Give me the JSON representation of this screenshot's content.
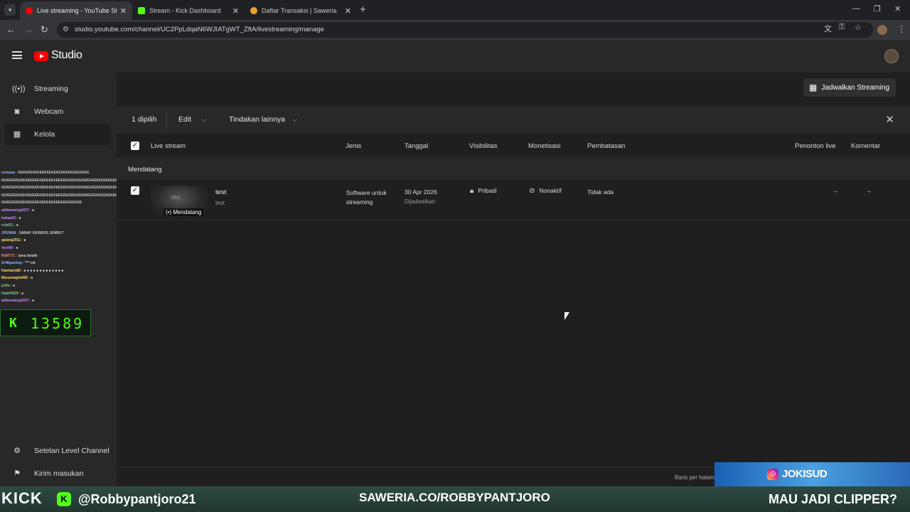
{
  "browser": {
    "tabs": [
      {
        "title": "Live streaming - YouTube Studio",
        "active": true,
        "favicon_color": "#ff0000"
      },
      {
        "title": "Stream - Kick Dashboard",
        "active": false,
        "favicon_color": "#53fc18"
      },
      {
        "title": "Daftar Transaksi | Saweria",
        "active": false,
        "favicon_color": "#f0a030"
      }
    ],
    "url": "studio.youtube.com/channel/UC2PpLdqaN6WJIATgWT_ZftA/livestreaming/manage"
  },
  "header": {
    "logo_text": "Studio"
  },
  "sidebar": {
    "items": [
      {
        "label": "Streaming",
        "icon": "broadcast-icon"
      },
      {
        "label": "Webcam",
        "icon": "camera-icon"
      },
      {
        "label": "Kelola",
        "icon": "calendar-icon"
      }
    ],
    "bottom_items": [
      {
        "label": "Setelan Level Channel",
        "icon": "gear-icon"
      },
      {
        "label": "Kirim masukan",
        "icon": "feedback-icon"
      }
    ]
  },
  "chat": {
    "lines": [
      {
        "user": "notepaa :",
        "text": "KEKEKEKEKEKEKEKEKEKEKEKEKEKEKE",
        "color": "#8ab4f8"
      },
      {
        "user": "",
        "text": "KEKEKEKEKEKEKEKEKEKEKEKEKEKEKEKEKEKEKEKEKEKEKEKEKEKEKE",
        "color": "#ffffff"
      },
      {
        "user": "",
        "text": "KEKEKEKEKEKEKEKEKEKEKEKEKEKEKEKEKEKEKEKEKEKEKEKEKEKEKE",
        "color": "#ffffff"
      },
      {
        "user": "",
        "text": "KEKEKEKEKEKEKEKEKEKEKEKEKEKEKEKEKEKEKEKEKEKEKEKEKEKEKE",
        "color": "#ffffff"
      },
      {
        "user": "",
        "text": "KEKEKEKEKEKEKEKEKEKEKEKEKEKEKEKEKE",
        "color": "#ffffff"
      },
      {
        "user": "aditmewing1637 :",
        "text": "●",
        "color": "#c58af9"
      },
      {
        "user": "hahaa02 :",
        "text": "●",
        "color": "#c58af9"
      },
      {
        "user": "rchd21 :",
        "text": "●",
        "color": "#81c995"
      },
      {
        "user": "JPENNN :",
        "text": "SABAR VIEWERS JEMBUT",
        "color": "#8ab4f8"
      },
      {
        "user": "galang2911 :",
        "text": "●",
        "color": "#fdd663"
      },
      {
        "user": "Vent99 :",
        "text": "●",
        "color": "#c58af9"
      },
      {
        "user": "RAR771 :",
        "text": "lama botakk",
        "color": "#f28b82"
      },
      {
        "user": "Sr48gaming :",
        "text": "*** rob",
        "color": "#8ab4f8"
      },
      {
        "user": "Hanhann86 :",
        "text": "● ● ● ● ● ● ● ● ● ● ● ● ●",
        "color": "#fdd663"
      },
      {
        "user": "Manusiagila456 :",
        "text": "●",
        "color": "#fdd663"
      },
      {
        "user": "jedlo :",
        "text": "●",
        "color": "#81c995"
      },
      {
        "user": "HadiFM29 :",
        "text": "●",
        "color": "#81c995"
      },
      {
        "user": "aditmewing1637 :",
        "text": "●",
        "color": "#c58af9"
      }
    ],
    "counter_prefix": "K",
    "counter_value": "13589"
  },
  "main": {
    "schedule_button": "Jadwalkan Streaming",
    "actionbar": {
      "selected": "1 dipilih",
      "edit": "Edit",
      "more_actions": "Tindakan lainnya"
    },
    "columns": [
      "Live stream",
      "Jenis",
      "Tanggal",
      "Visibilitas",
      "Monetisasi",
      "Pembatasan",
      "Penonton live",
      "Komentar"
    ],
    "section_label": "Mendatang",
    "rows": [
      {
        "title": "test",
        "description": "test",
        "thumb_text": "7/0/1",
        "badge": "(•) Mendatang",
        "type": "Software untuk streaming",
        "date": "30 Apr 2026",
        "date_sub": "Dijadwalkan",
        "visibility": "Pribadi",
        "monetization": "Nonaktif",
        "restriction": "Tidak ada",
        "live_viewers": "–",
        "comments": "–"
      }
    ],
    "rows_per_page": "Baris per halaman:"
  },
  "overlay": {
    "kick_text": "KICK",
    "handle": "@Robbypantjoro21",
    "saweria": "SAWERIA.CO/ROBBYPANTJORO",
    "clipper": "MAU JADI CLIPPER?",
    "ig_handle": "JOKISUD"
  }
}
